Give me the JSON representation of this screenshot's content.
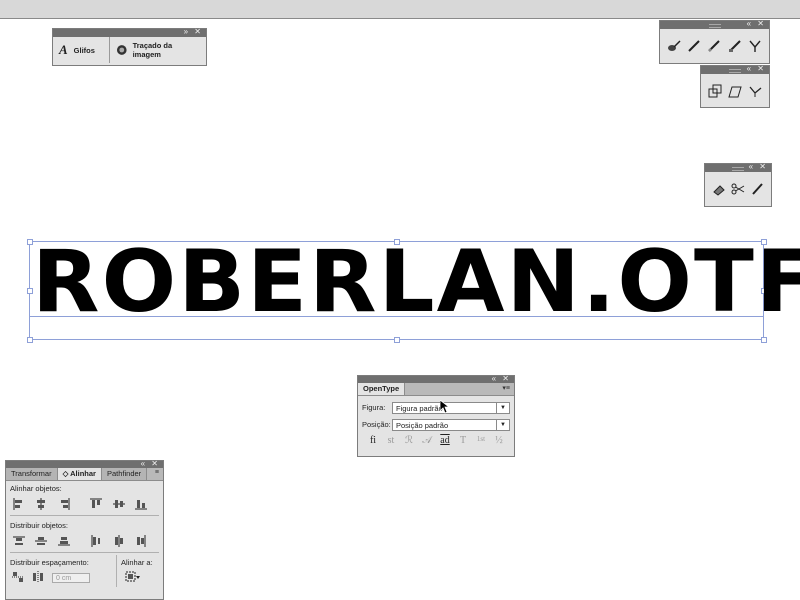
{
  "dock_panels": {
    "glyphs_label": "Glifos",
    "image_trace_label": "Traçado da imagem"
  },
  "artwork": {
    "text": "ROBERLAN.OTF"
  },
  "opentype": {
    "tab_label": "OpenType",
    "figure_label": "Figura:",
    "figure_value": "Figura padrão",
    "position_label": "Posição:",
    "position_value": "Posição padrão",
    "icons": [
      "fi",
      "st",
      "ℛ",
      "𝒜",
      "ad",
      "T",
      "1st",
      "½"
    ]
  },
  "align": {
    "tabs": [
      "Transformar",
      "◇ Alinhar",
      "Pathfinder"
    ],
    "align_objects_label": "Alinhar objetos:",
    "distribute_objects_label": "Distribuir objetos:",
    "distribute_spacing_label": "Distribuir espaçamento:",
    "align_to_label": "Alinhar a:",
    "spacing_value": "0 cm"
  },
  "colors": {
    "panel_bg": "#e4e4e4",
    "titlebar": "#6f6f6f",
    "selection": "#8ea0d8"
  }
}
